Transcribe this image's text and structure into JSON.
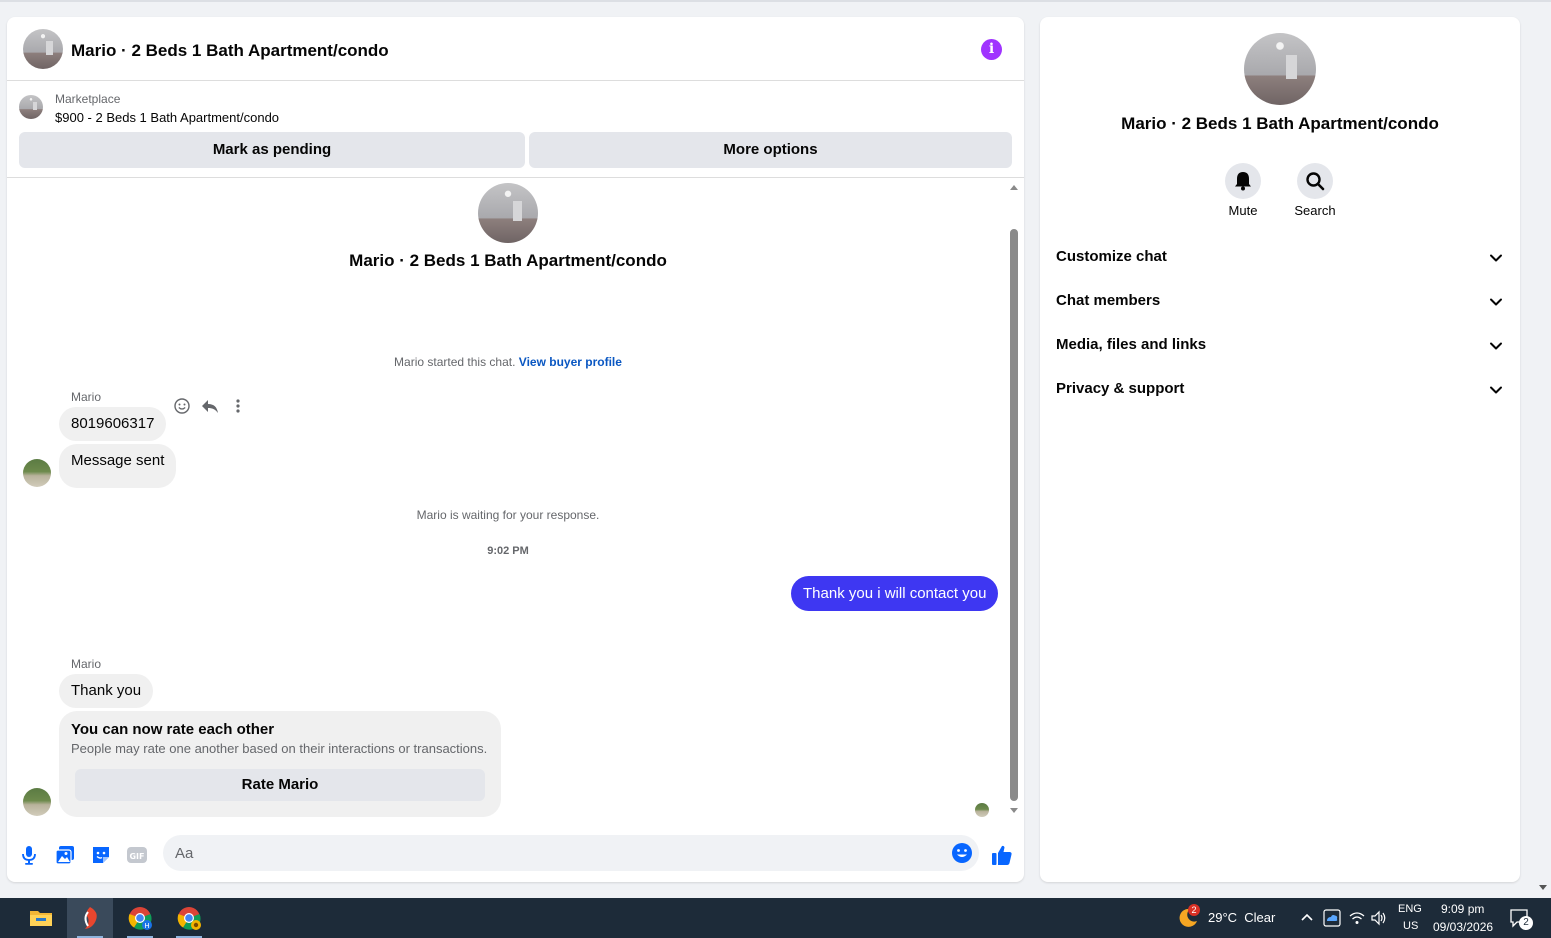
{
  "chat": {
    "header_title": "Mario · 2 Beds 1 Bath Apartment/condo",
    "listing": {
      "source": "Marketplace",
      "price_title": "$900 - 2 Beds 1 Bath Apartment/condo",
      "mark_pending_label": "Mark as pending",
      "more_options_label": "More options"
    },
    "intro_title": "Mario · 2 Beds 1 Bath Apartment/condo",
    "started_text": "Mario started this chat.",
    "view_profile_link": "View buyer profile",
    "messages": [
      {
        "sender": "Mario",
        "text": "8019606317"
      },
      {
        "text": "Message sent"
      },
      {
        "system": "Mario is waiting for your response."
      },
      {
        "timestamp": "9:02 PM"
      },
      {
        "outgoing": "Thank you i will contact you"
      },
      {
        "sender": "Mario",
        "text": "Thank you"
      }
    ],
    "rate_card": {
      "title": "You can now rate each other",
      "subtitle": "People may rate one another based on their interactions or transactions.",
      "button_label": "Rate Mario"
    },
    "composer": {
      "placeholder": "Aa"
    },
    "colors": {
      "accent": "#0866ff",
      "outgoing_bubble": "#3e37f2",
      "info_icon": "#a033ff"
    }
  },
  "info": {
    "title": "Mario · 2 Beds 1 Bath Apartment/condo",
    "mute_label": "Mute",
    "search_label": "Search",
    "sections": [
      "Customize chat",
      "Chat members",
      "Media, files and links",
      "Privacy & support"
    ]
  },
  "taskbar": {
    "weather_badge": "2",
    "weather": "29°C  Clear",
    "lang_top": "ENG",
    "lang_bottom": "US",
    "time": "9:09 pm",
    "date": "09/03/2026",
    "notification_count": "2"
  }
}
